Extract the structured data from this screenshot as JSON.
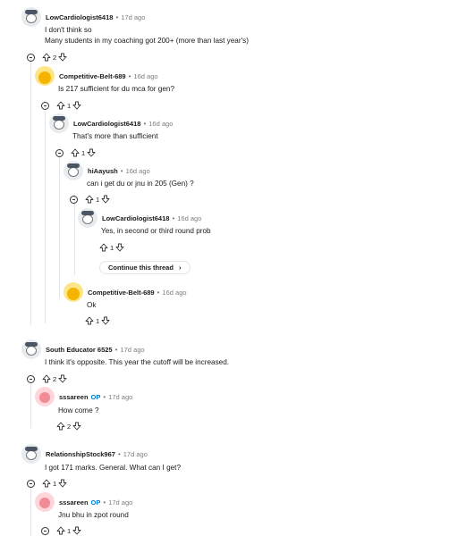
{
  "comments": [
    {
      "user": "LowCardiologist6418",
      "time": "17d ago",
      "lines": [
        "I don't think so",
        "Many students in my coaching got 200+ (more than last year's)"
      ],
      "score": "2"
    },
    {
      "user": "Competitive-Belt-689",
      "time": "16d ago",
      "lines": [
        "Is 217 sufficient for du mca for gen?"
      ],
      "score": "1"
    },
    {
      "user": "LowCardiologist6418",
      "time": "16d ago",
      "lines": [
        "That's more than sufficient"
      ],
      "score": "1"
    },
    {
      "user": "hiAayush",
      "time": "16d ago",
      "lines": [
        "can i get du or jnu in 205 (Gen) ?"
      ],
      "score": "1"
    },
    {
      "user": "LowCardiologist6418",
      "time": "16d ago",
      "lines": [
        "Yes, in second or third round prob"
      ],
      "score": "1"
    },
    {
      "user": "Competitive-Belt-689",
      "time": "16d ago",
      "lines": [
        "Ok"
      ],
      "score": "1"
    },
    {
      "user": "South Educator 6525",
      "time": "17d ago",
      "lines": [
        "I think it's opposite. This year the cutoff will be increased."
      ],
      "score": "2"
    },
    {
      "user": "sssareen",
      "op": "OP",
      "time": "17d ago",
      "lines": [
        "How come ?"
      ],
      "score": "2"
    },
    {
      "user": "RelationshipStock967",
      "time": "17d ago",
      "lines": [
        "I got 171 marks. General. What can I get?"
      ],
      "score": "1"
    },
    {
      "user": "sssareen",
      "op": "OP",
      "time": "17d ago",
      "lines": [
        "Jnu bhu in zpot round"
      ],
      "score": "1"
    }
  ],
  "continue_thread": {
    "label": "Continue this thread",
    "chevron": "›"
  },
  "meta_separator": "•",
  "icons": {
    "upvote": "upvote-icon",
    "downvote": "downvote-icon",
    "collapse": "collapse-icon"
  }
}
